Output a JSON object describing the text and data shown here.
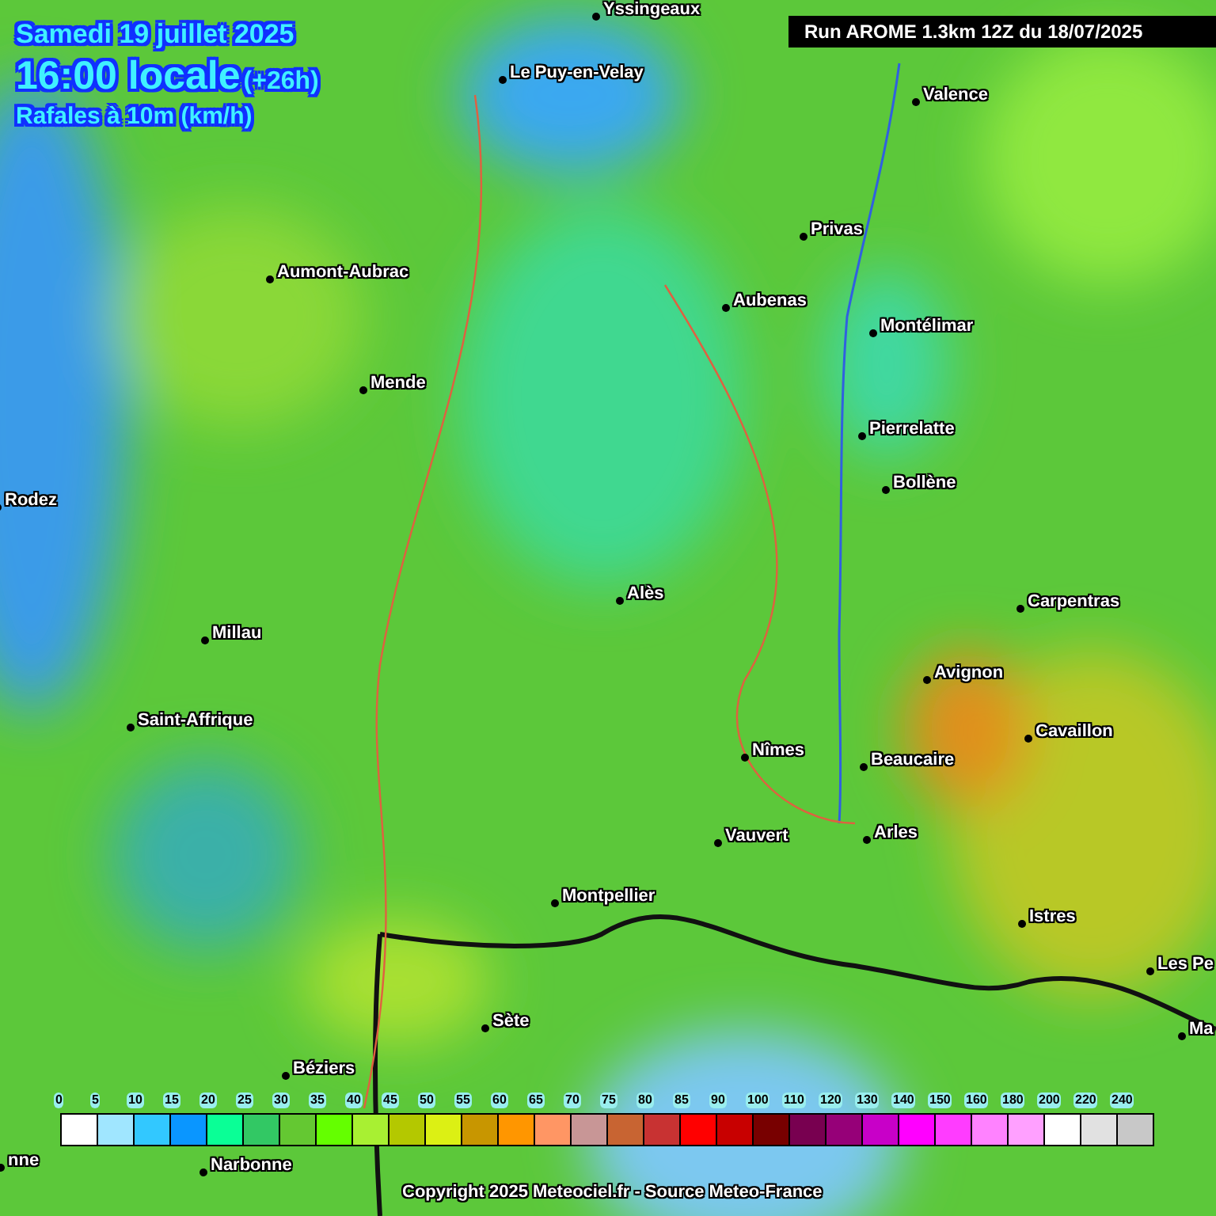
{
  "header": {
    "date": "Samedi 19 juillet 2025",
    "time": "16:00 locale",
    "offset": "(+26h)",
    "parameter": "Rafales à 10m (km/h)"
  },
  "run_banner": "Run AROME 1.3km 12Z du 18/07/2025",
  "cities": [
    {
      "name": "Yssingeaux"
    },
    {
      "name": "Le Puy-en-Velay"
    },
    {
      "name": "Valence"
    },
    {
      "name": "Privas"
    },
    {
      "name": "Aumont-Aubrac"
    },
    {
      "name": "Aubenas"
    },
    {
      "name": "Montélimar"
    },
    {
      "name": "Mende"
    },
    {
      "name": "Pierrelatte"
    },
    {
      "name": "Bollène"
    },
    {
      "name": "Rodez"
    },
    {
      "name": "Alès"
    },
    {
      "name": "Carpentras"
    },
    {
      "name": "Millau"
    },
    {
      "name": "Avignon"
    },
    {
      "name": "Saint-Affrique"
    },
    {
      "name": "Cavaillon"
    },
    {
      "name": "Nîmes"
    },
    {
      "name": "Beaucaire"
    },
    {
      "name": "Arles"
    },
    {
      "name": "Vauvert"
    },
    {
      "name": "Montpellier"
    },
    {
      "name": "Istres"
    },
    {
      "name": "Les Pe"
    },
    {
      "name": "Sète"
    },
    {
      "name": "Ma"
    },
    {
      "name": "Béziers"
    },
    {
      "name": "nne"
    },
    {
      "name": "Narbonne"
    }
  ],
  "legend": [
    {
      "label": "0",
      "color": "#ffffff"
    },
    {
      "label": "5",
      "color": "#a0e6ff"
    },
    {
      "label": "10",
      "color": "#32c8ff"
    },
    {
      "label": "15",
      "color": "#0a96ff"
    },
    {
      "label": "20",
      "color": "#0aff96"
    },
    {
      "label": "25",
      "color": "#32c864"
    },
    {
      "label": "30",
      "color": "#64c832"
    },
    {
      "label": "35",
      "color": "#64ff00"
    },
    {
      "label": "40",
      "color": "#a8f032"
    },
    {
      "label": "45",
      "color": "#b4c800"
    },
    {
      "label": "50",
      "color": "#dcf014"
    },
    {
      "label": "55",
      "color": "#c89600"
    },
    {
      "label": "60",
      "color": "#ff9600"
    },
    {
      "label": "65",
      "color": "#ff9664"
    },
    {
      "label": "70",
      "color": "#c89696"
    },
    {
      "label": "75",
      "color": "#c86432"
    },
    {
      "label": "80",
      "color": "#c83232"
    },
    {
      "label": "85",
      "color": "#ff0000"
    },
    {
      "label": "90",
      "color": "#c80000"
    },
    {
      "label": "100",
      "color": "#780000"
    },
    {
      "label": "110",
      "color": "#780050"
    },
    {
      "label": "120",
      "color": "#960078"
    },
    {
      "label": "130",
      "color": "#c800c8"
    },
    {
      "label": "140",
      "color": "#ff00ff"
    },
    {
      "label": "150",
      "color": "#ff3cff"
    },
    {
      "label": "160",
      "color": "#ff82ff"
    },
    {
      "label": "180",
      "color": "#ffa0ff"
    },
    {
      "label": "200",
      "color": "#ffffff"
    },
    {
      "label": "220",
      "color": "#e1e1e1"
    },
    {
      "label": "240",
      "color": "#c8c8c8"
    }
  ],
  "copyright": "Copyright 2025 Meteociel.fr - Source Meteo-France"
}
